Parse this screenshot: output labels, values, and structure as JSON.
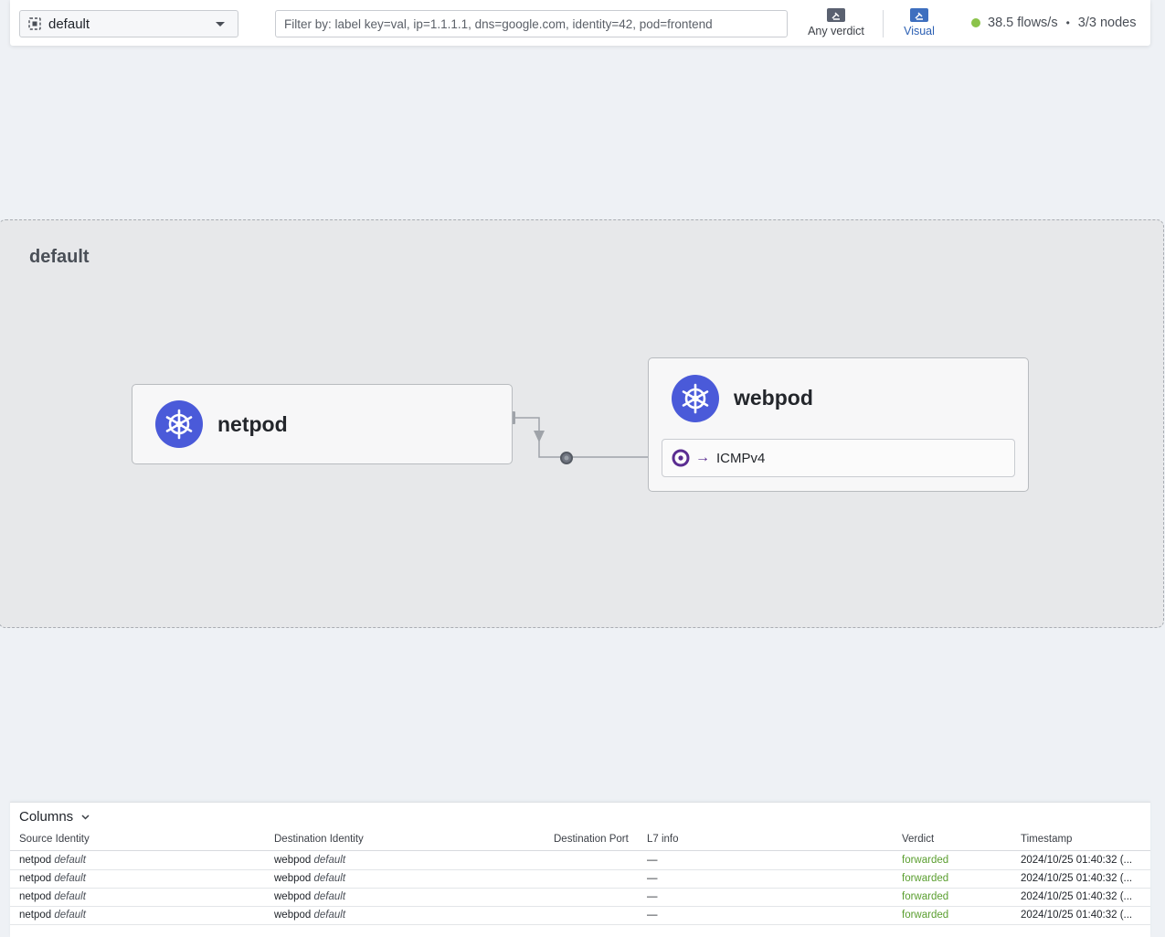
{
  "topbar": {
    "namespace": "default",
    "filter_placeholder": "Filter by: label key=val, ip=1.1.1.1, dns=google.com, identity=42, pod=frontend",
    "verdict_label": "Any verdict",
    "visual_label": "Visual",
    "flows_rate": "38.5 flows/s",
    "separator": "•",
    "nodes": "3/3 nodes",
    "status_color": "#8bc34a"
  },
  "map": {
    "namespace_title": "default",
    "nodes": [
      {
        "name": "netpod"
      },
      {
        "name": "webpod",
        "ports": [
          {
            "direction": "→",
            "protocol": "ICMPv4"
          }
        ]
      }
    ]
  },
  "flows": {
    "columns_label": "Columns",
    "headers": {
      "source": "Source Identity",
      "destination": "Destination Identity",
      "dest_port": "Destination Port",
      "l7": "L7 info",
      "verdict": "Verdict",
      "timestamp": "Timestamp"
    },
    "rows": [
      {
        "src": "netpod",
        "src_ns": "default",
        "dst": "webpod",
        "dst_ns": "default",
        "port": "",
        "l7": "—",
        "verdict": "forwarded",
        "timestamp": "2024/10/25 01:40:32 (..."
      },
      {
        "src": "netpod",
        "src_ns": "default",
        "dst": "webpod",
        "dst_ns": "default",
        "port": "",
        "l7": "—",
        "verdict": "forwarded",
        "timestamp": "2024/10/25 01:40:32 (..."
      },
      {
        "src": "netpod",
        "src_ns": "default",
        "dst": "webpod",
        "dst_ns": "default",
        "port": "",
        "l7": "—",
        "verdict": "forwarded",
        "timestamp": "2024/10/25 01:40:32 (..."
      },
      {
        "src": "netpod",
        "src_ns": "default",
        "dst": "webpod",
        "dst_ns": "default",
        "port": "",
        "l7": "—",
        "verdict": "forwarded",
        "timestamp": "2024/10/25 01:40:32 (..."
      }
    ]
  },
  "colors": {
    "k8s_blue": "#4a5ad9",
    "port_purple": "#5a2d91",
    "verdict_green": "#5a9e2f",
    "visual_blue": "#3e6fbf"
  }
}
